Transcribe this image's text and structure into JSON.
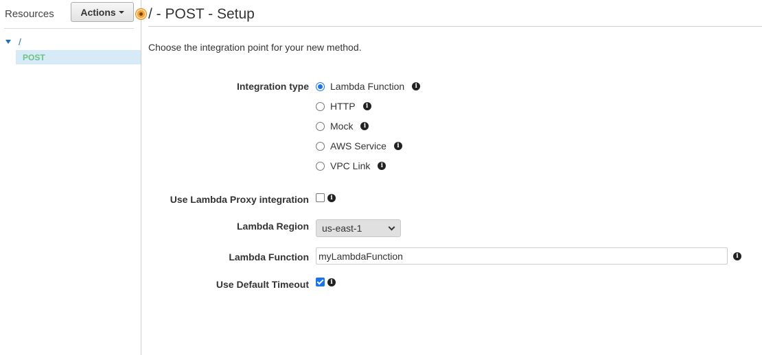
{
  "sidebar": {
    "title": "Resources",
    "actions_label": "Actions",
    "tree": {
      "root_label": "/",
      "child_label": "POST"
    }
  },
  "main": {
    "title": "/ - POST - Setup",
    "intro": "Choose the integration point for your new method.",
    "integration_type": {
      "label": "Integration type",
      "selected": "Lambda Function",
      "options": [
        {
          "label": "Lambda Function",
          "checked": true
        },
        {
          "label": "HTTP",
          "checked": false
        },
        {
          "label": "Mock",
          "checked": false
        },
        {
          "label": "AWS Service",
          "checked": false
        },
        {
          "label": "VPC Link",
          "checked": false
        }
      ]
    },
    "proxy": {
      "label": "Use Lambda Proxy integration",
      "checked": false
    },
    "region": {
      "label": "Lambda Region",
      "value": "us-east-1"
    },
    "function": {
      "label": "Lambda Function",
      "value": "myLambdaFunction"
    },
    "timeout": {
      "label": "Use Default Timeout",
      "checked": true
    }
  },
  "colors": {
    "accent_blue": "#1a73e8",
    "link_blue": "#1f6fb2",
    "selected_bg": "#d6eaf8",
    "post_green": "#6cc280",
    "status_orange": "#f0a23c"
  },
  "icons": {
    "info": "info-icon",
    "status": "status-dot-icon",
    "caret": "caret-down-icon",
    "tree_toggle": "tree-expand-icon",
    "select_chevron": "chevron-down-icon"
  }
}
